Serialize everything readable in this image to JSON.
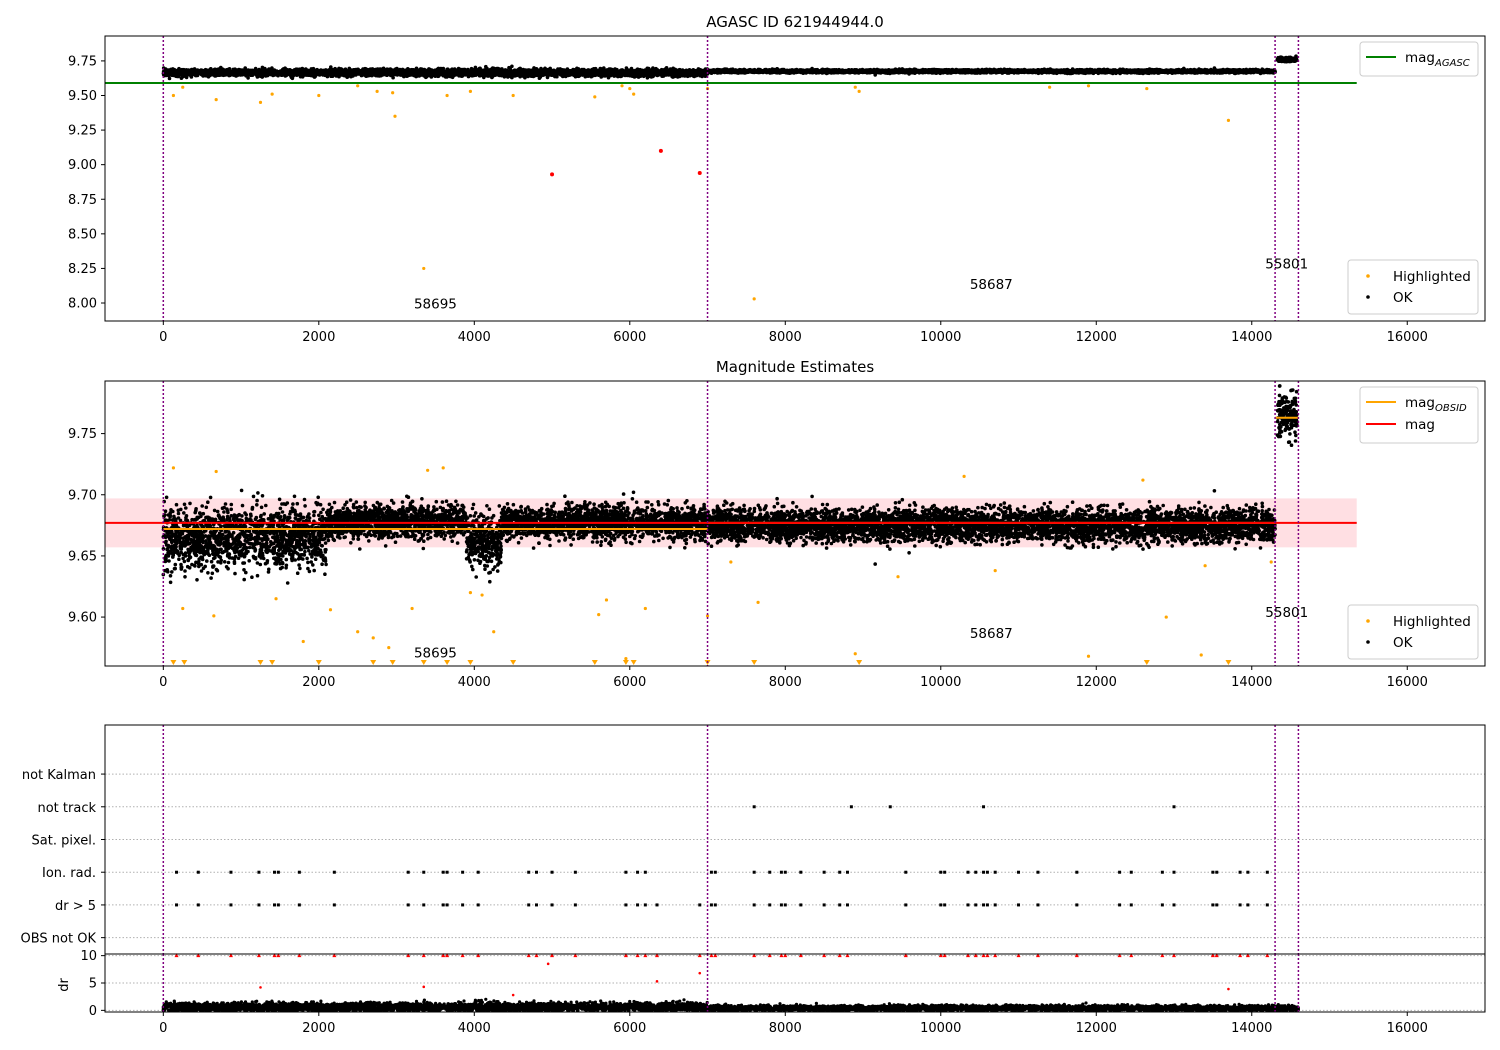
{
  "colors": {
    "ok": "#000000",
    "highlighted": "#ffa500",
    "flagged": "#ff0000",
    "mag_agasc": "#008000",
    "mag_obsid": "#ffa500",
    "mag": "#ff0000",
    "band": "#ffc0c8",
    "obs_divider": "#800080",
    "grid": "#b0b0b0"
  },
  "chart_data": [
    {
      "id": "panel1",
      "type": "scatter",
      "title": "AGASC ID 621944944.0",
      "xlim": [
        -750,
        17000
      ],
      "ylim": [
        7.87,
        9.93
      ],
      "xticks": [
        0,
        2000,
        4000,
        6000,
        8000,
        10000,
        12000,
        14000,
        16000
      ],
      "xtick_labels": [
        "0",
        "2000",
        "4000",
        "6000",
        "8000",
        "10000",
        "12000",
        "14000",
        "16000"
      ],
      "yticks": [
        8.0,
        8.25,
        8.5,
        8.75,
        9.0,
        9.25,
        9.5,
        9.75
      ],
      "ytick_labels": [
        "8.00",
        "8.25",
        "8.50",
        "8.75",
        "9.00",
        "9.25",
        "9.50",
        "9.75"
      ],
      "legend_lines": [
        {
          "label": "mag",
          "subscript": "AGASC",
          "color": "#008000"
        }
      ],
      "legend_points": [
        {
          "label": "Highlighted",
          "color": "#ffa500"
        },
        {
          "label": "OK",
          "color": "#000000"
        }
      ],
      "hlines": [
        {
          "name": "mag_AGASC",
          "y": 9.59,
          "x_range": [
            -750,
            15350
          ],
          "color": "#008000"
        }
      ],
      "obs_boundaries": [
        0,
        7000,
        14300,
        14600
      ],
      "obs_labels": [
        {
          "text": "58695",
          "x": 3500,
          "y": 7.96
        },
        {
          "text": "58687",
          "x": 10650,
          "y": 8.1
        },
        {
          "text": "55801",
          "x": 14450,
          "y": 8.25
        }
      ],
      "ok_series": [
        {
          "x_range": [
            0,
            7000
          ],
          "center": 9.665,
          "spread": 0.022
        },
        {
          "x_range": [
            7000,
            14300
          ],
          "center": 9.675,
          "spread": 0.01
        },
        {
          "x_range": [
            14330,
            14580
          ],
          "center": 9.76,
          "spread": 0.013
        }
      ],
      "highlighted_points": [
        {
          "x": 130,
          "y": 9.5
        },
        {
          "x": 250,
          "y": 9.56
        },
        {
          "x": 680,
          "y": 9.47
        },
        {
          "x": 1250,
          "y": 9.45
        },
        {
          "x": 1400,
          "y": 9.51
        },
        {
          "x": 2000,
          "y": 9.5
        },
        {
          "x": 2500,
          "y": 9.57
        },
        {
          "x": 2750,
          "y": 9.53
        },
        {
          "x": 2950,
          "y": 9.52
        },
        {
          "x": 2980,
          "y": 9.35
        },
        {
          "x": 3350,
          "y": 8.25
        },
        {
          "x": 3650,
          "y": 9.5
        },
        {
          "x": 3950,
          "y": 9.53
        },
        {
          "x": 4500,
          "y": 9.5
        },
        {
          "x": 5550,
          "y": 9.49
        },
        {
          "x": 5900,
          "y": 9.57
        },
        {
          "x": 6000,
          "y": 9.55
        },
        {
          "x": 6050,
          "y": 9.51
        },
        {
          "x": 7000,
          "y": 9.55
        },
        {
          "x": 7600,
          "y": 8.03
        },
        {
          "x": 8900,
          "y": 9.56
        },
        {
          "x": 8950,
          "y": 9.53
        },
        {
          "x": 11400,
          "y": 9.56
        },
        {
          "x": 11900,
          "y": 9.57
        },
        {
          "x": 12650,
          "y": 9.55
        },
        {
          "x": 13700,
          "y": 9.32
        }
      ],
      "flagged_points": [
        {
          "x": 5000,
          "y": 8.93
        },
        {
          "x": 6400,
          "y": 9.1
        },
        {
          "x": 6900,
          "y": 8.94
        }
      ]
    },
    {
      "id": "panel2",
      "type": "scatter",
      "title": "Magnitude Estimates",
      "xlim": [
        -750,
        17000
      ],
      "ylim": [
        9.56,
        9.793
      ],
      "xticks": [
        0,
        2000,
        4000,
        6000,
        8000,
        10000,
        12000,
        14000,
        16000
      ],
      "xtick_labels": [
        "0",
        "2000",
        "4000",
        "6000",
        "8000",
        "10000",
        "12000",
        "14000",
        "16000"
      ],
      "yticks": [
        9.6,
        9.65,
        9.7,
        9.75
      ],
      "ytick_labels": [
        "9.60",
        "9.65",
        "9.70",
        "9.75"
      ],
      "legend_lines": [
        {
          "label": "mag",
          "subscript": "OBSID",
          "color": "#ffa500"
        },
        {
          "label": "mag",
          "subscript": "",
          "color": "#ff0000"
        }
      ],
      "legend_points": [
        {
          "label": "Highlighted",
          "color": "#ffa500"
        },
        {
          "label": "OK",
          "color": "#000000"
        }
      ],
      "hlines": [
        {
          "name": "mag",
          "y": 9.677,
          "x_range": [
            -750,
            15350
          ],
          "color": "#ff0000"
        }
      ],
      "band": {
        "y_range": [
          9.657,
          9.697
        ],
        "x_range": [
          -750,
          15350
        ]
      },
      "obsid_segments": [
        {
          "x_range": [
            0,
            7000
          ],
          "y": 9.672
        },
        {
          "x_range": [
            7000,
            14300
          ],
          "y": 9.677
        },
        {
          "x_range": [
            14300,
            14600
          ],
          "y": 9.763
        }
      ],
      "obs_boundaries": [
        0,
        7000,
        14300,
        14600
      ],
      "obs_labels": [
        {
          "text": "58695",
          "x": 3500,
          "y": 9.567
        },
        {
          "text": "58687",
          "x": 10650,
          "y": 9.583
        },
        {
          "text": "55801",
          "x": 14450,
          "y": 9.6
        }
      ],
      "ok_series": [
        {
          "x_range": [
            0,
            2100
          ],
          "center": 9.665,
          "spread": 0.022
        },
        {
          "x_range": [
            2100,
            3900
          ],
          "center": 9.678,
          "spread": 0.012
        },
        {
          "x_range": [
            3900,
            4350
          ],
          "center": 9.662,
          "spread": 0.02
        },
        {
          "x_range": [
            4350,
            7000
          ],
          "center": 9.677,
          "spread": 0.012
        },
        {
          "x_range": [
            7000,
            14300
          ],
          "center": 9.675,
          "spread": 0.012
        },
        {
          "x_range": [
            14330,
            14580
          ],
          "center": 9.765,
          "spread": 0.015
        }
      ],
      "highlighted_points": [
        {
          "x": 130,
          "y": 9.722
        },
        {
          "x": 250,
          "y": 9.607
        },
        {
          "x": 680,
          "y": 9.719
        },
        {
          "x": 650,
          "y": 9.601
        },
        {
          "x": 1450,
          "y": 9.615
        },
        {
          "x": 1800,
          "y": 9.58
        },
        {
          "x": 2150,
          "y": 9.606
        },
        {
          "x": 2500,
          "y": 9.588
        },
        {
          "x": 2700,
          "y": 9.583
        },
        {
          "x": 2900,
          "y": 9.575
        },
        {
          "x": 3200,
          "y": 9.607
        },
        {
          "x": 3400,
          "y": 9.72
        },
        {
          "x": 3600,
          "y": 9.722
        },
        {
          "x": 3950,
          "y": 9.62
        },
        {
          "x": 4100,
          "y": 9.618
        },
        {
          "x": 4250,
          "y": 9.588
        },
        {
          "x": 5600,
          "y": 9.602
        },
        {
          "x": 5700,
          "y": 9.614
        },
        {
          "x": 5950,
          "y": 9.566
        },
        {
          "x": 6200,
          "y": 9.607
        },
        {
          "x": 7000,
          "y": 9.601
        },
        {
          "x": 7300,
          "y": 9.645
        },
        {
          "x": 7650,
          "y": 9.612
        },
        {
          "x": 8900,
          "y": 9.57
        },
        {
          "x": 9450,
          "y": 9.633
        },
        {
          "x": 10300,
          "y": 9.715
        },
        {
          "x": 10700,
          "y": 9.638
        },
        {
          "x": 11900,
          "y": 9.568
        },
        {
          "x": 12600,
          "y": 9.712
        },
        {
          "x": 12900,
          "y": 9.6
        },
        {
          "x": 13350,
          "y": 9.569
        },
        {
          "x": 13400,
          "y": 9.642
        },
        {
          "x": 14250,
          "y": 9.645
        }
      ],
      "clipped_markers": [
        130,
        270,
        1250,
        1400,
        2000,
        2700,
        2950,
        3350,
        3650,
        3950,
        4500,
        5550,
        5950,
        6050,
        7000,
        7600,
        8950,
        12650,
        13700
      ]
    },
    {
      "id": "panel3",
      "type": "scatter",
      "xlim": [
        -750,
        17000
      ],
      "ylim": [
        -0.5,
        6.5
      ],
      "categories": [
        "OBS not OK",
        "dr > 5",
        "Ion. rad.",
        "Sat. pixel.",
        "not track",
        "not Kalman"
      ],
      "flags": {
        "dr > 5": [
          170,
          450,
          870,
          1230,
          1430,
          1480,
          1750,
          2200,
          3150,
          3350,
          3600,
          3650,
          3850,
          4050,
          4700,
          4800,
          5000,
          5300,
          5950,
          6100,
          6200,
          6350,
          6900,
          7050,
          7100,
          7600,
          7800,
          7950,
          8000,
          8200,
          8500,
          8700,
          8800,
          9550,
          10000,
          10050,
          10350,
          10450,
          10550,
          10600,
          10700,
          11000,
          11250,
          11750,
          12300,
          12450,
          12850,
          13000,
          13500,
          13550,
          13850,
          13950,
          14200
        ],
        "Ion. rad.": [
          170,
          450,
          870,
          1230,
          1430,
          1480,
          1750,
          2200,
          3150,
          3350,
          3600,
          3650,
          3850,
          4050,
          4700,
          4800,
          5000,
          5300,
          5950,
          6100,
          6200,
          7050,
          7100,
          7600,
          7800,
          7950,
          8000,
          8200,
          8500,
          8700,
          8800,
          9550,
          10000,
          10050,
          10350,
          10450,
          10550,
          10600,
          10700,
          11000,
          11250,
          11750,
          12300,
          12450,
          12850,
          13000,
          13500,
          13550,
          13850,
          13950,
          14200
        ],
        "not track": [
          7600,
          8850,
          9350,
          10550,
          13000
        ]
      }
    },
    {
      "id": "panel4",
      "type": "scatter",
      "ylabel": "dr",
      "xlim": [
        -750,
        17000
      ],
      "ylim": [
        -0.3,
        10.3
      ],
      "xticks": [
        0,
        2000,
        4000,
        6000,
        8000,
        10000,
        12000,
        14000,
        16000
      ],
      "xtick_labels": [
        "0",
        "2000",
        "4000",
        "6000",
        "8000",
        "10000",
        "12000",
        "14000",
        "16000"
      ],
      "yticks": [
        0,
        5,
        10
      ],
      "ytick_labels": [
        "0",
        "5",
        "10"
      ],
      "flagged_points": [
        {
          "x": 4950,
          "y": 8.5
        },
        {
          "x": 6350,
          "y": 5.3
        },
        {
          "x": 6900,
          "y": 6.8
        },
        {
          "x": 1250,
          "y": 4.2
        },
        {
          "x": 3350,
          "y": 4.3
        },
        {
          "x": 4500,
          "y": 2.8
        },
        {
          "x": 13700,
          "y": 3.9
        }
      ],
      "clipped_at": 10,
      "ok_series": [
        {
          "x_range": [
            0,
            7000
          ],
          "center": 0.6,
          "spread": 0.4
        },
        {
          "x_range": [
            7000,
            14600
          ],
          "center": 0.4,
          "spread": 0.25
        }
      ]
    }
  ]
}
